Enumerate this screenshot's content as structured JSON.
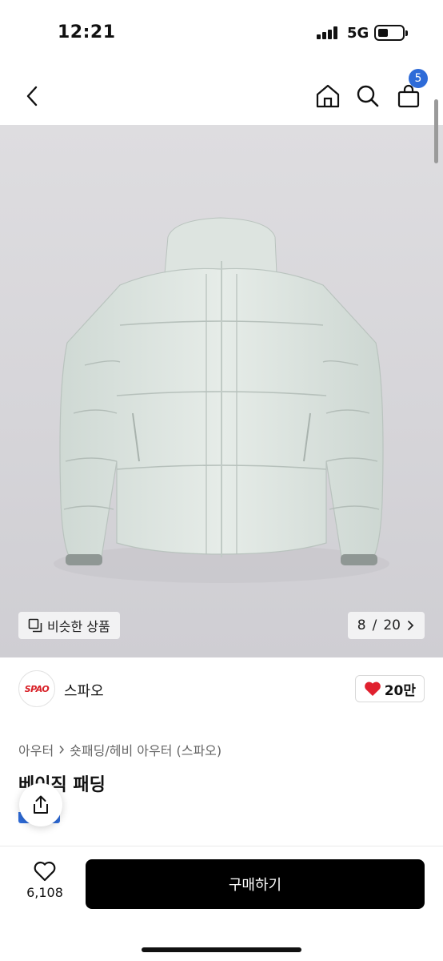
{
  "status_bar": {
    "time": "12:21",
    "network": "5G"
  },
  "nav": {
    "cart_count": "5"
  },
  "gallery": {
    "similar_label": "비슷한 상품",
    "current_page": "8",
    "separator": "/",
    "total_pages": "20"
  },
  "brand": {
    "logo_text": "SPAO",
    "name": "스파오",
    "like_count": "20만"
  },
  "product": {
    "breadcrumb": [
      "아우터",
      "숏패딩/헤비 아우터 (스파오)"
    ],
    "title": "베이직 패딩"
  },
  "bottom_bar": {
    "wish_count": "6,108",
    "buy_label": "구매하기"
  },
  "colors": {
    "accent": "#2e6bd8",
    "heart": "#e0202e",
    "brand_red": "#d81f26",
    "buy_button": "#000000"
  }
}
